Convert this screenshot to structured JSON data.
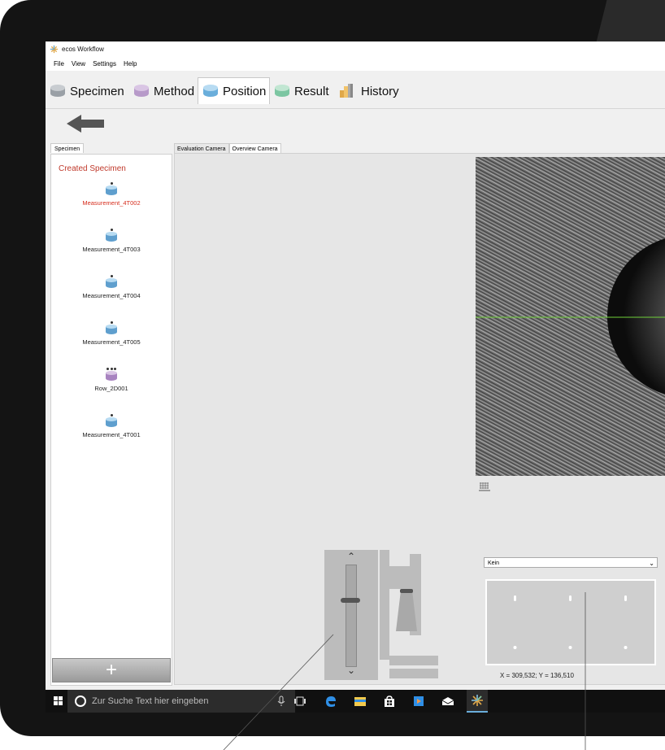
{
  "window": {
    "title": "ecos Workflow"
  },
  "menu": [
    "File",
    "View",
    "Settings",
    "Help"
  ],
  "main_tabs": [
    {
      "label": "Specimen",
      "color": "#9aa0a6"
    },
    {
      "label": "Method",
      "color": "#b79ac9"
    },
    {
      "label": "Position",
      "color": "#6aaedb"
    },
    {
      "label": "Result",
      "color": "#7cc6a2"
    },
    {
      "label": "History",
      "color": "#e0a84a"
    }
  ],
  "active_tab": "Position",
  "left_panel": {
    "tab_label": "Specimen",
    "title": "Created Specimen",
    "items": [
      {
        "label": "Measurement_4T002",
        "selected": true,
        "icon": "single-specimen-icon"
      },
      {
        "label": "Measurement_4T003",
        "selected": false,
        "icon": "single-specimen-icon"
      },
      {
        "label": "Measurement_4T004",
        "selected": false,
        "icon": "single-specimen-icon"
      },
      {
        "label": "Measurement_4T005",
        "selected": false,
        "icon": "single-specimen-icon"
      },
      {
        "label": "Row_2D001",
        "selected": false,
        "icon": "row-specimen-icon"
      },
      {
        "label": "Measurement_4T001",
        "selected": false,
        "icon": "single-specimen-icon"
      }
    ],
    "add_label": "+"
  },
  "camera_tabs": [
    "Evaluation Camera",
    "Overview Camera"
  ],
  "active_camera_tab": "Overview Camera",
  "position": {
    "dropdown_value": "Kein",
    "coordinates": "X = 309,532; Y = 136,510"
  },
  "taskbar": {
    "search_placeholder": "Zur Suche Text hier eingeben"
  },
  "colors": {
    "selected_text": "#d62e1e",
    "title_text": "#c0392b",
    "crosshair": "#6fcf3a"
  }
}
